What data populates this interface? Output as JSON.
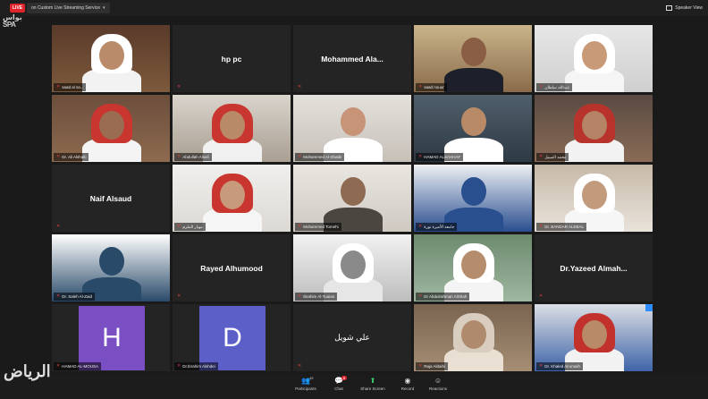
{
  "topbar": {
    "live_label": "LIVE",
    "stream_status": "on Custom Live Streaming Service",
    "view_label": "Speaker View"
  },
  "logo_text": [
    "بواس",
    "SPA"
  ],
  "tiles": [
    {
      "type": "video",
      "label": "saad al sa...",
      "active": true,
      "muted": true,
      "palette": "room-portraits"
    },
    {
      "type": "name",
      "name": "hp pc",
      "muted": true
    },
    {
      "type": "name",
      "name": "Mohammed   Ala...",
      "muted": true
    },
    {
      "type": "video",
      "label": "saad nouur",
      "muted": true,
      "palette": "office-suit"
    },
    {
      "type": "video",
      "label": "عبدالله سلطان",
      "muted": true,
      "palette": "white-ghutra"
    },
    {
      "type": "video",
      "label": "Dr. Ali Alshalti",
      "muted": true,
      "palette": "shemagh-red"
    },
    {
      "type": "video",
      "label": "Abdullah Alsafi",
      "muted": true,
      "palette": "window-light"
    },
    {
      "type": "video",
      "label": "Mohammed Al-Shatbi",
      "muted": true,
      "palette": "family"
    },
    {
      "type": "video",
      "label": "HAMAD ALSAHHAF",
      "muted": true,
      "palette": "glasses"
    },
    {
      "type": "video",
      "label": "محمد الصبيل",
      "muted": true,
      "palette": "shemagh-red-2"
    },
    {
      "type": "name",
      "name": "Naif Alsaud",
      "muted": true
    },
    {
      "type": "video",
      "label": "مهيار الملزم",
      "muted": true,
      "palette": "young-shemagh"
    },
    {
      "type": "video",
      "label": "Mohammed Tomehi",
      "muted": true,
      "palette": "bald"
    },
    {
      "type": "video",
      "label": "جامعة الأميرة نورة",
      "muted": true,
      "palette": "blue-pattern"
    },
    {
      "type": "video",
      "label": "Dr. BANDAR ALEBAL",
      "muted": true,
      "palette": "white-ghutra-2"
    },
    {
      "type": "video",
      "label": "Dr. Saleh Al-Zaid",
      "muted": true,
      "palette": "logo-badge"
    },
    {
      "type": "name",
      "name": "Rayed Alhumood",
      "muted": true
    },
    {
      "type": "video",
      "label": "Ibrahim Al-Tuaian",
      "muted": true,
      "palette": "portrait-bw"
    },
    {
      "type": "video",
      "label": "Dr Abdulrahman AlShah",
      "muted": true,
      "palette": "outdoor"
    },
    {
      "type": "name",
      "name": "Dr.Yazeed   Almah...",
      "muted": true
    },
    {
      "type": "letter",
      "letter": "H",
      "color": "#7a4fc4",
      "label": "HAMAD AL-MOUSA",
      "muted": true
    },
    {
      "type": "letter",
      "letter": "D",
      "color": "#5b5fc7",
      "label": "Dr.Ibrahim Alshdei",
      "muted": true
    },
    {
      "type": "arabic",
      "name": "علي شويل",
      "muted": true
    },
    {
      "type": "video",
      "label": "Raja Aldaihi",
      "muted": true,
      "palette": "sepia"
    },
    {
      "type": "video",
      "label": "Dr. Khaled Alrumaih",
      "muted": true,
      "palette": "red-shemagh-blue"
    }
  ],
  "toolbar": {
    "participants_label": "Participants",
    "participants_count": "45",
    "chat_label": "Chat",
    "chat_badge": "8",
    "share_label": "Share Screen",
    "record_label": "Record",
    "reactions_label": "Reactions"
  },
  "watermark": "الرياض",
  "colors": {
    "live_red": "#e0242b",
    "active_border": "#d7e23a",
    "share_green": "#3ccf6e",
    "muted_red": "#e03b3b"
  }
}
